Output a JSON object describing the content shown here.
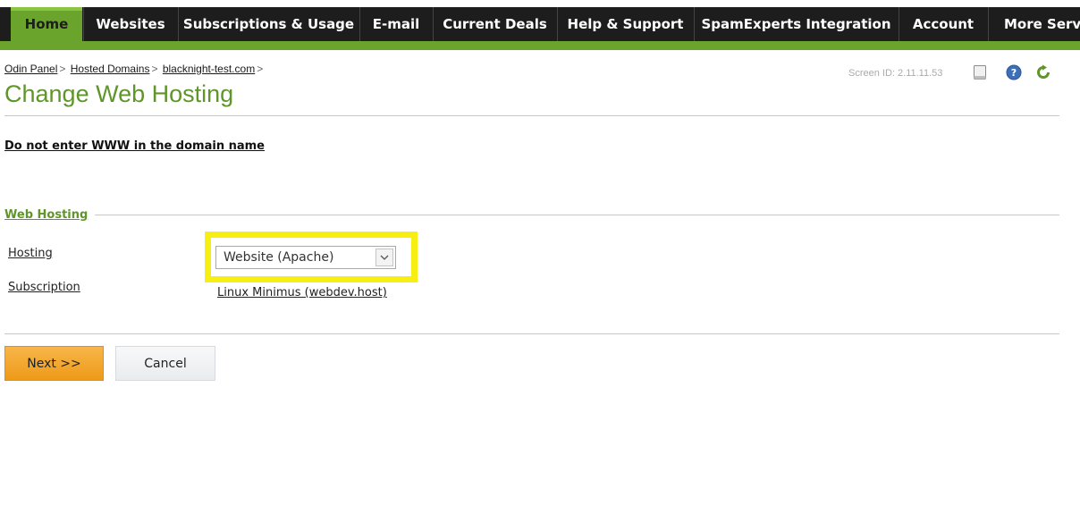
{
  "nav": {
    "tabs": [
      {
        "label": "Home",
        "active": true
      },
      {
        "label": "Websites"
      },
      {
        "label": "Subscriptions & Usage"
      },
      {
        "label": "E-mail"
      },
      {
        "label": "Current Deals"
      },
      {
        "label": "Help & Support"
      },
      {
        "label": "SpamExperts Integration"
      },
      {
        "label": "Account"
      },
      {
        "label": "More Servic"
      }
    ]
  },
  "breadcrumb": {
    "items": [
      "Odin Panel",
      "Hosted Domains",
      "blacknight-test.com"
    ],
    "separator": ">"
  },
  "page": {
    "title": "Change Web Hosting",
    "screen_id": "Screen ID: 2.11.11.53",
    "warning": "Do not enter WWW in the domain name"
  },
  "form": {
    "section_title": "Web Hosting",
    "hosting_label": "Hosting",
    "hosting_value": "Website (Apache)",
    "subscription_label": "Subscription",
    "subscription_value": "Linux Minimus (webdev.host)"
  },
  "buttons": {
    "next": "Next >>",
    "cancel": "Cancel"
  },
  "icons": {
    "tools": [
      "document-icon",
      "help-icon",
      "refresh-icon"
    ]
  },
  "colors": {
    "accent_green": "#6ba42d",
    "title_green": "#5f9529",
    "highlight_yellow": "#f7ee14",
    "next_orange": "#f0a22a",
    "nav_dark": "#1d1d1d"
  }
}
